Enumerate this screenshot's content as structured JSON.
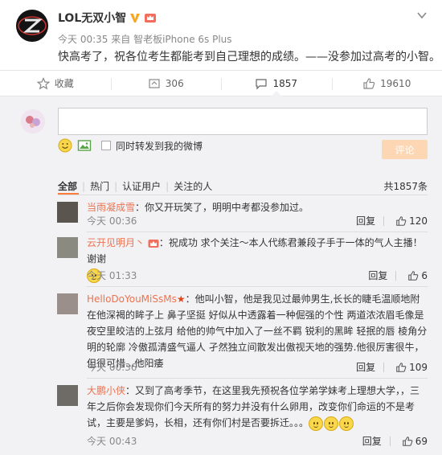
{
  "post": {
    "author": "LOL无双小智",
    "time": "今天 00:35",
    "source_prefix": "来自",
    "source": "智老板iPhone 6s Plus",
    "text": "快高考了，祝各位考生都能考到自己理想的成绩。——没参加过高考的小智。"
  },
  "actions": {
    "favorite": "收藏",
    "repost": "306",
    "comment": "1857",
    "like": "19610"
  },
  "composer": {
    "also_repost": "同时转发到我的微博",
    "submit": "评论"
  },
  "filter": {
    "tabs": [
      "全部",
      "热门",
      "认证用户",
      "关注的人"
    ],
    "total": "共1857条"
  },
  "comments": [
    {
      "user": "当雨凝成雪",
      "text": "：你又开玩笑了，明明中考都没参加过。",
      "time": "今天 00:36",
      "reply": "回复",
      "likes": "120"
    },
    {
      "user": "云开见明月丶",
      "text": "：祝成功  求个关注～本人代练君兼段子手于一体的气人主播！谢谢",
      "time": "今天 01:33",
      "reply": "回复",
      "likes": "6"
    },
    {
      "user": "HelloDoYouMiSsMs",
      "text": "：他叫小智，他是我见过最帅男生,长长的睫毛温顺地附在他深褐的眸子上 鼻子坚挺 好似从中透露着一种倔强的个性 两道浓浓眉毛像是夜空里皎洁的上弦月 给他的帅气中加入了一丝不羁 锐利的黑眸 轻抿的唇 棱角分明的轮廓 冷傲孤清盛气逼人 孑然独立间散发出傲视天地的强势.他很厉害很牛，但很可惜...他阳痿",
      "time": "今天 00:36",
      "reply": "回复",
      "likes": "109"
    },
    {
      "user": "大鹏小侠",
      "text": "：又到了高考季节，在这里我先预祝各位学弟学妹考上理想大学，，三年之后你会发现你们今天所有的努力并没有什么卵用，改变你们命运的不是考试，主要是爹妈，长相，还有你们村是否要拆迁。。。",
      "time": "今天 00:43",
      "reply": "回复",
      "likes": "69"
    }
  ],
  "colors": {
    "accent": "#eb7350",
    "submit_bg": "#fdd7b4",
    "panel_bg": "#f2f2f5"
  }
}
